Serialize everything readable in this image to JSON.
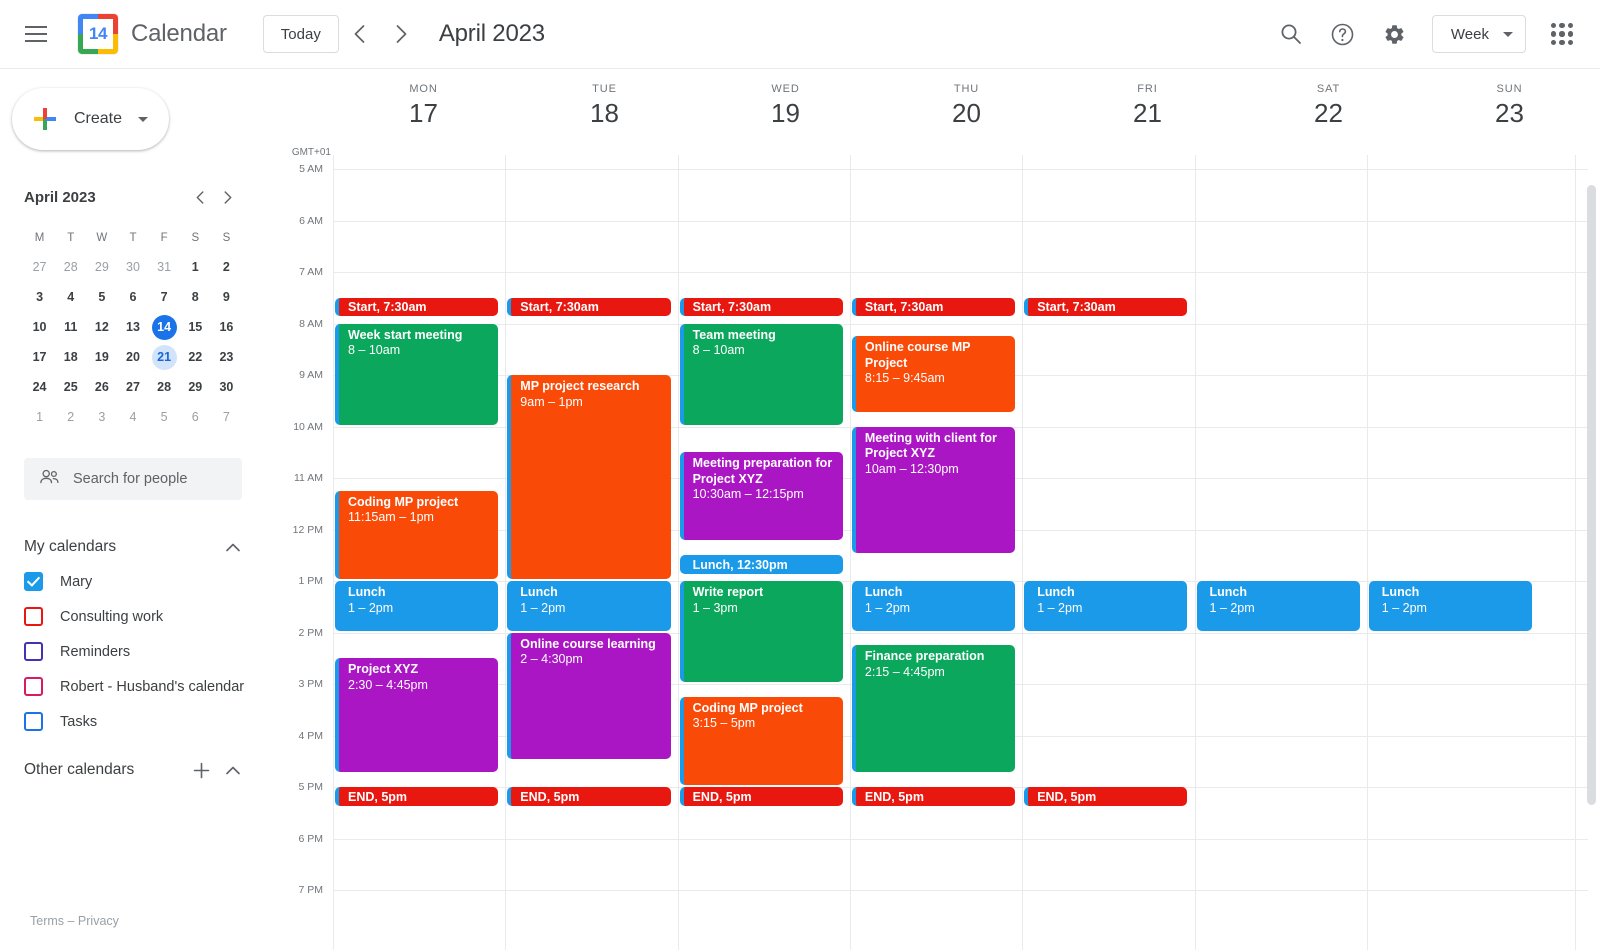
{
  "header": {
    "menu_icon": "hamburger-icon",
    "logo_day": "14",
    "app_title": "Calendar",
    "today_label": "Today",
    "prev_icon": "chevron-left-icon",
    "next_icon": "chevron-right-icon",
    "period_title": "April 2023",
    "search_icon": "search-icon",
    "help_icon": "help-icon",
    "settings_icon": "gear-icon",
    "view_label": "Week",
    "apps_icon": "apps-grid-icon"
  },
  "sidebar": {
    "create_label": "Create",
    "mini_calendar": {
      "title": "April 2023",
      "prev_icon": "chevron-left-icon",
      "next_icon": "chevron-right-icon",
      "dow": [
        "M",
        "T",
        "W",
        "T",
        "F",
        "S",
        "S"
      ],
      "weeks": [
        [
          {
            "d": "27",
            "m": true
          },
          {
            "d": "28",
            "m": true
          },
          {
            "d": "29",
            "m": true
          },
          {
            "d": "30",
            "m": true
          },
          {
            "d": "31",
            "m": true
          },
          {
            "d": "1",
            "m": false
          },
          {
            "d": "2",
            "m": false
          }
        ],
        [
          {
            "d": "3",
            "m": false
          },
          {
            "d": "4",
            "m": false
          },
          {
            "d": "5",
            "m": false
          },
          {
            "d": "6",
            "m": false
          },
          {
            "d": "7",
            "m": false
          },
          {
            "d": "8",
            "m": false
          },
          {
            "d": "9",
            "m": false
          }
        ],
        [
          {
            "d": "10",
            "m": false
          },
          {
            "d": "11",
            "m": false
          },
          {
            "d": "12",
            "m": false
          },
          {
            "d": "13",
            "m": false
          },
          {
            "d": "14",
            "m": false,
            "today": true
          },
          {
            "d": "15",
            "m": false
          },
          {
            "d": "16",
            "m": false
          }
        ],
        [
          {
            "d": "17",
            "m": false
          },
          {
            "d": "18",
            "m": false
          },
          {
            "d": "19",
            "m": false
          },
          {
            "d": "20",
            "m": false
          },
          {
            "d": "21",
            "m": false,
            "sel": true
          },
          {
            "d": "22",
            "m": false
          },
          {
            "d": "23",
            "m": false
          }
        ],
        [
          {
            "d": "24",
            "m": false
          },
          {
            "d": "25",
            "m": false
          },
          {
            "d": "26",
            "m": false
          },
          {
            "d": "27",
            "m": false
          },
          {
            "d": "28",
            "m": false
          },
          {
            "d": "29",
            "m": false
          },
          {
            "d": "30",
            "m": false
          }
        ],
        [
          {
            "d": "1",
            "m": true
          },
          {
            "d": "2",
            "m": true
          },
          {
            "d": "3",
            "m": true
          },
          {
            "d": "4",
            "m": true
          },
          {
            "d": "5",
            "m": true
          },
          {
            "d": "6",
            "m": true
          },
          {
            "d": "7",
            "m": true
          }
        ]
      ]
    },
    "search_people": {
      "icon": "people-icon",
      "placeholder": "Search for people"
    },
    "my_calendars": {
      "title": "My calendars",
      "collapse_icon": "chevron-up-icon",
      "items": [
        {
          "label": "Mary",
          "color": "#1a9ae8",
          "checked": true
        },
        {
          "label": "Consulting work",
          "color": "#e8170f",
          "checked": false
        },
        {
          "label": "Reminders",
          "color": "#4631b4",
          "checked": false
        },
        {
          "label": "Robert - Husband's calendar",
          "color": "#d81b60",
          "checked": false
        },
        {
          "label": "Tasks",
          "color": "#1a73e8",
          "checked": false
        }
      ]
    },
    "other_calendars": {
      "title": "Other calendars",
      "add_icon": "plus-icon",
      "collapse_icon": "chevron-up-icon"
    },
    "footer": "Terms – Privacy"
  },
  "calendar": {
    "timezone": "GMT+01",
    "hours": [
      "5 AM",
      "6 AM",
      "7 AM",
      "8 AM",
      "9 AM",
      "10 AM",
      "11 AM",
      "12 PM",
      "1 PM",
      "2 PM",
      "3 PM",
      "4 PM",
      "5 PM",
      "6 PM",
      "7 PM"
    ],
    "days": [
      {
        "dow": "MON",
        "num": "17"
      },
      {
        "dow": "TUE",
        "num": "18"
      },
      {
        "dow": "WED",
        "num": "19"
      },
      {
        "dow": "THU",
        "num": "20"
      },
      {
        "dow": "FRI",
        "num": "21"
      },
      {
        "dow": "SAT",
        "num": "22"
      },
      {
        "dow": "SUN",
        "num": "23"
      }
    ],
    "colors": {
      "red": "#e8170f",
      "green": "#0ba75c",
      "orange": "#fa4a08",
      "purple": "#ab16c4",
      "blue": "#1a9ae8",
      "accent_bar": "#1a9ae8"
    },
    "events": [
      {
        "day": 0,
        "title": "Start, 7:30am",
        "time": "",
        "start": 7.5,
        "end": 7.9,
        "color": "red",
        "inline": true
      },
      {
        "day": 0,
        "title": "Week start meeting",
        "time": "8 – 10am",
        "start": 8.0,
        "end": 10.0,
        "color": "green",
        "inline": false
      },
      {
        "day": 0,
        "title": "Coding MP project",
        "time": "11:15am – 1pm",
        "start": 11.25,
        "end": 13.0,
        "color": "orange",
        "inline": false
      },
      {
        "day": 0,
        "title": "Lunch",
        "time": "1 – 2pm",
        "start": 13.0,
        "end": 14.0,
        "color": "blue",
        "inline": false
      },
      {
        "day": 0,
        "title": "Project XYZ",
        "time": "2:30 – 4:45pm",
        "start": 14.5,
        "end": 16.75,
        "color": "purple",
        "inline": false
      },
      {
        "day": 0,
        "title": "END, 5pm",
        "time": "",
        "start": 17.0,
        "end": 17.4,
        "color": "red",
        "inline": true
      },
      {
        "day": 1,
        "title": "Start, 7:30am",
        "time": "",
        "start": 7.5,
        "end": 7.9,
        "color": "red",
        "inline": true
      },
      {
        "day": 1,
        "title": "MP project research",
        "time": "9am – 1pm",
        "start": 9.0,
        "end": 13.0,
        "color": "orange",
        "inline": false
      },
      {
        "day": 1,
        "title": "Lunch",
        "time": "1 – 2pm",
        "start": 13.0,
        "end": 14.0,
        "color": "blue",
        "inline": false
      },
      {
        "day": 1,
        "title": "Online course learning",
        "time": "2 – 4:30pm",
        "start": 14.0,
        "end": 16.5,
        "color": "purple",
        "inline": false
      },
      {
        "day": 1,
        "title": "END, 5pm",
        "time": "",
        "start": 17.0,
        "end": 17.4,
        "color": "red",
        "inline": true
      },
      {
        "day": 2,
        "title": "Start, 7:30am",
        "time": "",
        "start": 7.5,
        "end": 7.9,
        "color": "red",
        "inline": true
      },
      {
        "day": 2,
        "title": "Team meeting",
        "time": "8 – 10am",
        "start": 8.0,
        "end": 10.0,
        "color": "green",
        "inline": false
      },
      {
        "day": 2,
        "title": "Meeting preparation for Project XYZ",
        "time": "10:30am – 12:15pm",
        "start": 10.5,
        "end": 12.25,
        "color": "purple",
        "inline": false
      },
      {
        "day": 2,
        "title": "Lunch, 12:30pm",
        "time": "",
        "start": 12.5,
        "end": 12.9,
        "color": "blue",
        "inline": true
      },
      {
        "day": 2,
        "title": "Write report",
        "time": "1 – 3pm",
        "start": 13.0,
        "end": 15.0,
        "color": "green",
        "inline": false
      },
      {
        "day": 2,
        "title": "Coding MP project",
        "time": "3:15 – 5pm",
        "start": 15.25,
        "end": 17.0,
        "color": "orange",
        "inline": false
      },
      {
        "day": 2,
        "title": "END, 5pm",
        "time": "",
        "start": 17.0,
        "end": 17.4,
        "color": "red",
        "inline": true
      },
      {
        "day": 3,
        "title": "Start, 7:30am",
        "time": "",
        "start": 7.5,
        "end": 7.9,
        "color": "red",
        "inline": true
      },
      {
        "day": 3,
        "title": "Online course MP Project",
        "time": "8:15 – 9:45am",
        "start": 8.25,
        "end": 9.75,
        "color": "orange",
        "inline": false
      },
      {
        "day": 3,
        "title": "Meeting with client for Project XYZ",
        "time": "10am – 12:30pm",
        "start": 10.0,
        "end": 12.5,
        "color": "purple",
        "inline": false
      },
      {
        "day": 3,
        "title": "Lunch",
        "time": "1 – 2pm",
        "start": 13.0,
        "end": 14.0,
        "color": "blue",
        "inline": false
      },
      {
        "day": 3,
        "title": "Finance preparation",
        "time": "2:15 – 4:45pm",
        "start": 14.25,
        "end": 16.75,
        "color": "green",
        "inline": false
      },
      {
        "day": 3,
        "title": "END, 5pm",
        "time": "",
        "start": 17.0,
        "end": 17.4,
        "color": "red",
        "inline": true
      },
      {
        "day": 4,
        "title": "Start, 7:30am",
        "time": "",
        "start": 7.5,
        "end": 7.9,
        "color": "red",
        "inline": true
      },
      {
        "day": 4,
        "title": "Lunch",
        "time": "1 – 2pm",
        "start": 13.0,
        "end": 14.0,
        "color": "blue",
        "inline": false
      },
      {
        "day": 4,
        "title": "END, 5pm",
        "time": "",
        "start": 17.0,
        "end": 17.4,
        "color": "red",
        "inline": true
      },
      {
        "day": 5,
        "title": "Lunch",
        "time": "1 – 2pm",
        "start": 13.0,
        "end": 14.0,
        "color": "blue",
        "inline": false
      },
      {
        "day": 6,
        "title": "Lunch",
        "time": "1 – 2pm",
        "start": 13.0,
        "end": 14.0,
        "color": "blue",
        "inline": false
      }
    ]
  }
}
